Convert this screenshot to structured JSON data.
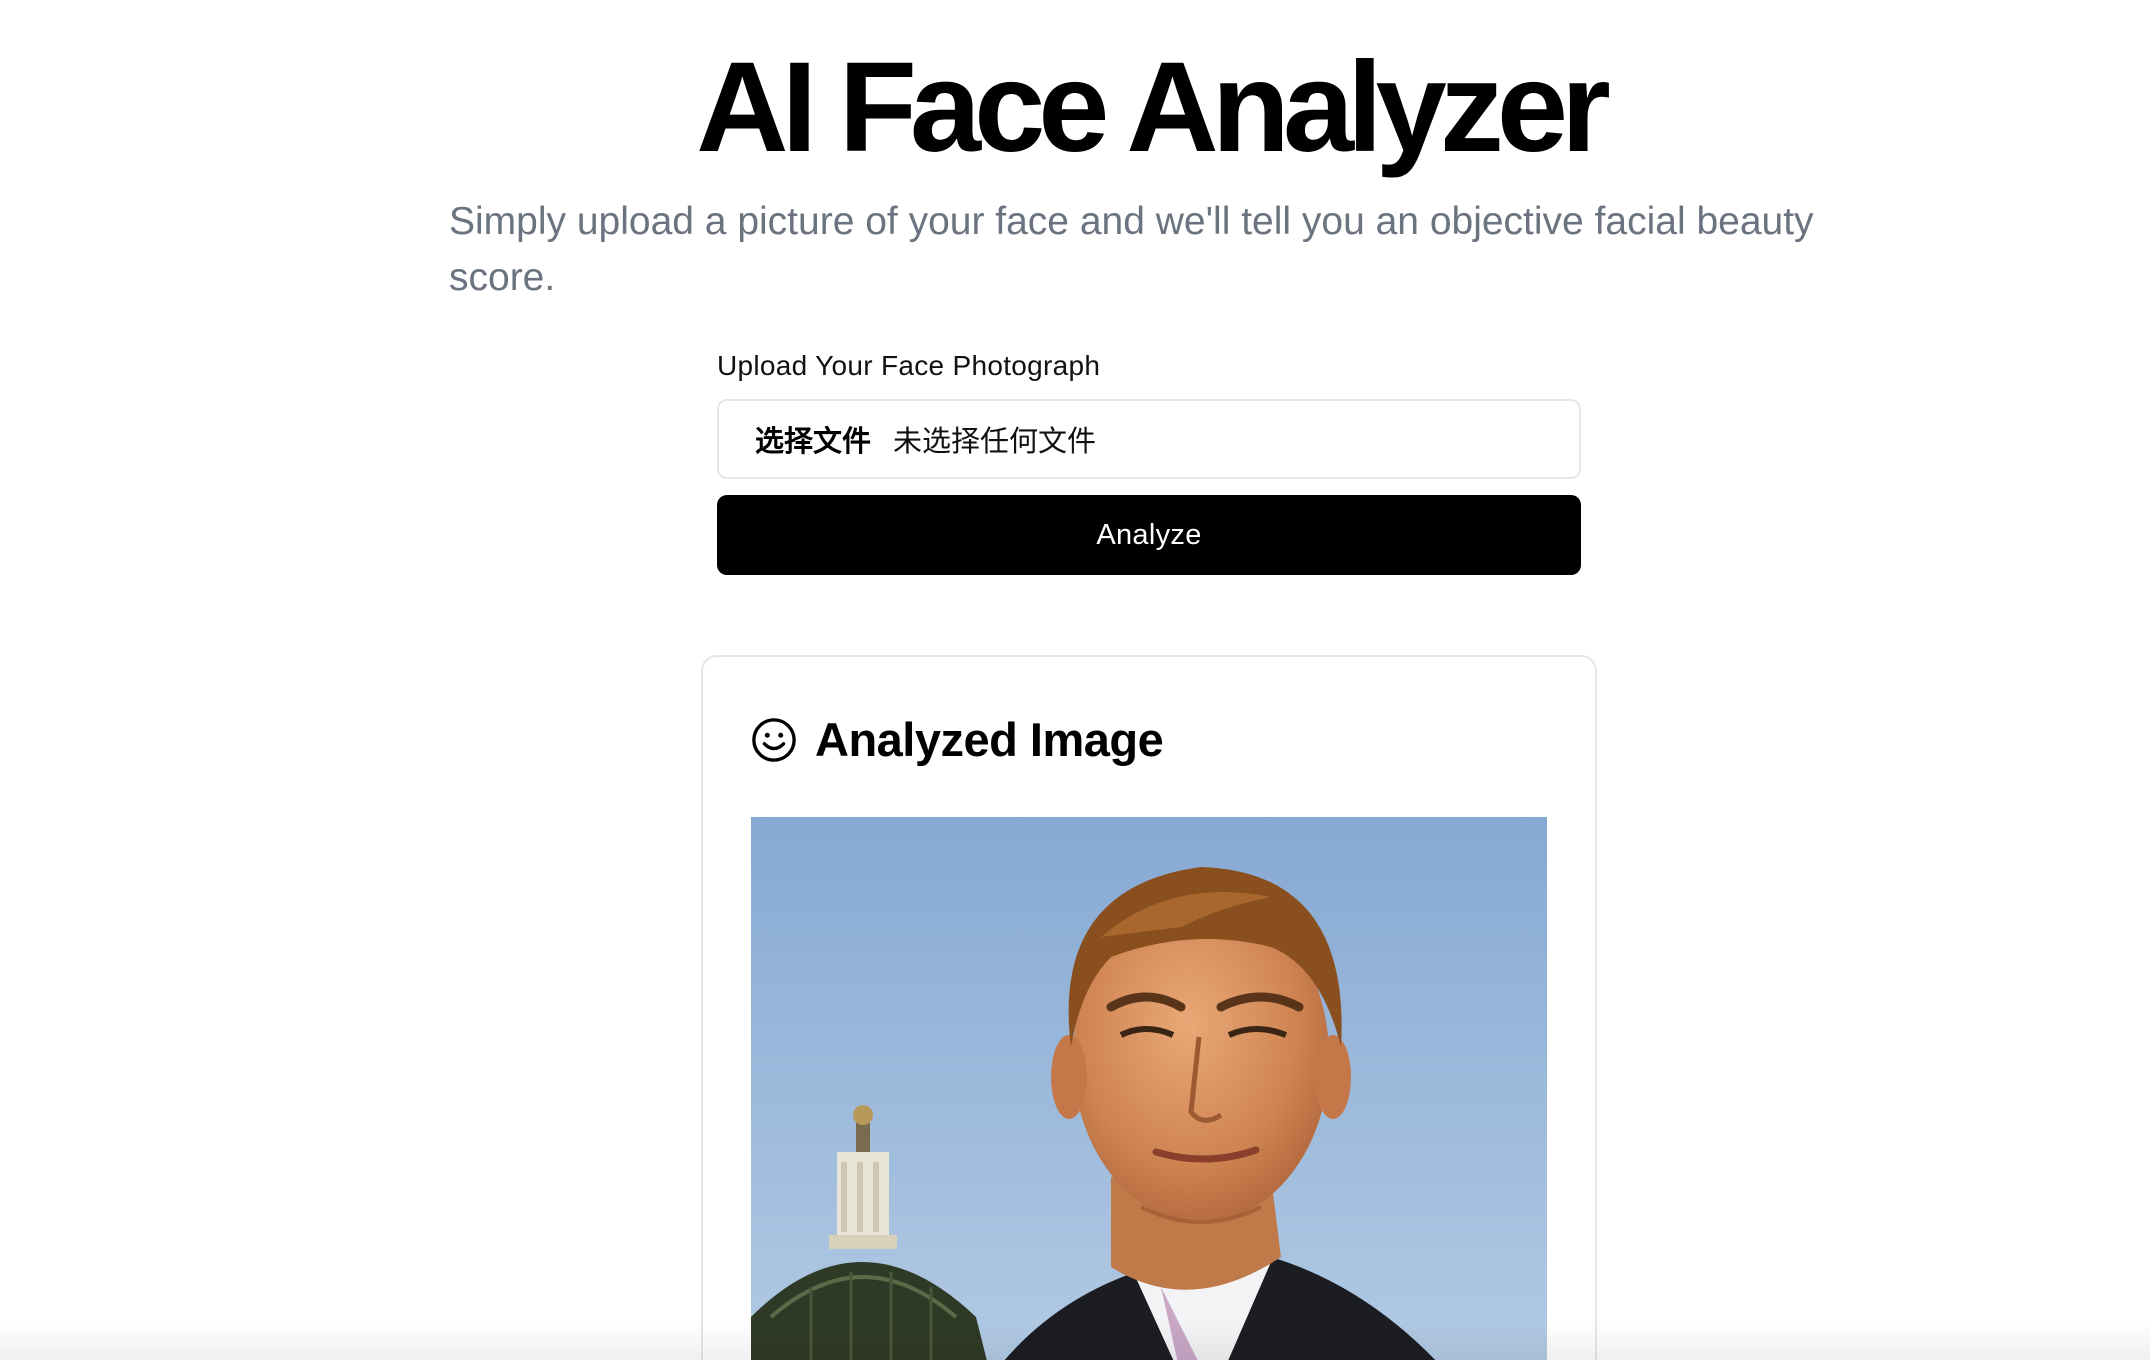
{
  "header": {
    "title": "AI Face Analyzer",
    "subtitle": "Simply upload a picture of your face and we'll tell you an objective facial beauty score."
  },
  "upload": {
    "label": "Upload Your Face Photograph",
    "choose_button": "选择文件",
    "no_file_text": "未选择任何文件"
  },
  "analyze_button": "Analyze",
  "result_card": {
    "title": "Analyzed Image",
    "icon": "smile-icon"
  },
  "colors": {
    "button_bg": "#000000",
    "subtitle": "#6b7280",
    "border": "#e5e7eb",
    "sky": "#8fb1d6"
  }
}
